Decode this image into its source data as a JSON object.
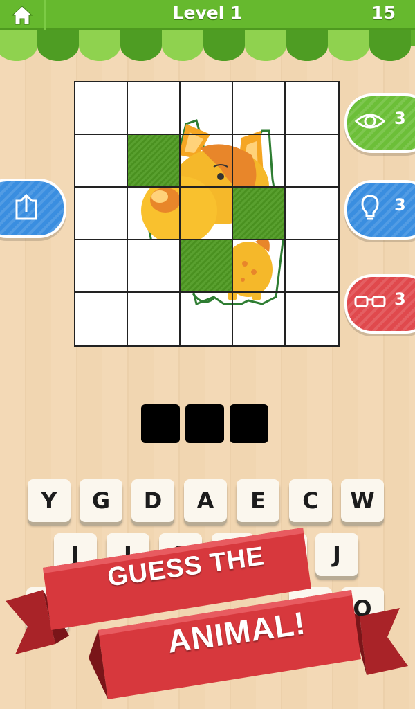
{
  "header": {
    "level_label": "Level 1",
    "coins": "15",
    "home_icon": "home-icon",
    "bar_color": "#66b92e"
  },
  "board": {
    "rows": 5,
    "cols": 5,
    "tiles": [
      [
        "covered",
        "covered",
        "open",
        "open",
        "covered"
      ],
      [
        "covered",
        "green",
        "open",
        "open",
        "covered"
      ],
      [
        "covered",
        "open",
        "open",
        "green",
        "covered"
      ],
      [
        "covered",
        "covered",
        "green",
        "open",
        "covered"
      ],
      [
        "covered",
        "covered",
        "open",
        "open",
        "covered"
      ]
    ],
    "hidden_image": "cartoon-dog"
  },
  "powerups": {
    "reveal": {
      "icon": "eye-icon",
      "count": "3",
      "color": "#6cbf38"
    },
    "hint": {
      "icon": "lightbulb-icon",
      "count": "3",
      "color": "#3a8ee0"
    },
    "glasses": {
      "icon": "glasses-icon",
      "count": "3",
      "color": "#e0494d"
    },
    "share": {
      "icon": "share-icon",
      "color": "#3a8ee0"
    }
  },
  "answer": {
    "slots": [
      "",
      "",
      ""
    ]
  },
  "keyboard": {
    "row1": [
      "Y",
      "G",
      "D",
      "A",
      "E",
      "C",
      "W"
    ],
    "row2": [
      "J",
      "I",
      "O",
      "",
      "",
      "",
      "J"
    ],
    "row3": [
      "",
      "",
      "",
      "",
      "",
      "D",
      "O"
    ]
  },
  "banner": {
    "line1": "GUESS THE",
    "line2": "ANIMAL!",
    "color": "#d7383d"
  }
}
